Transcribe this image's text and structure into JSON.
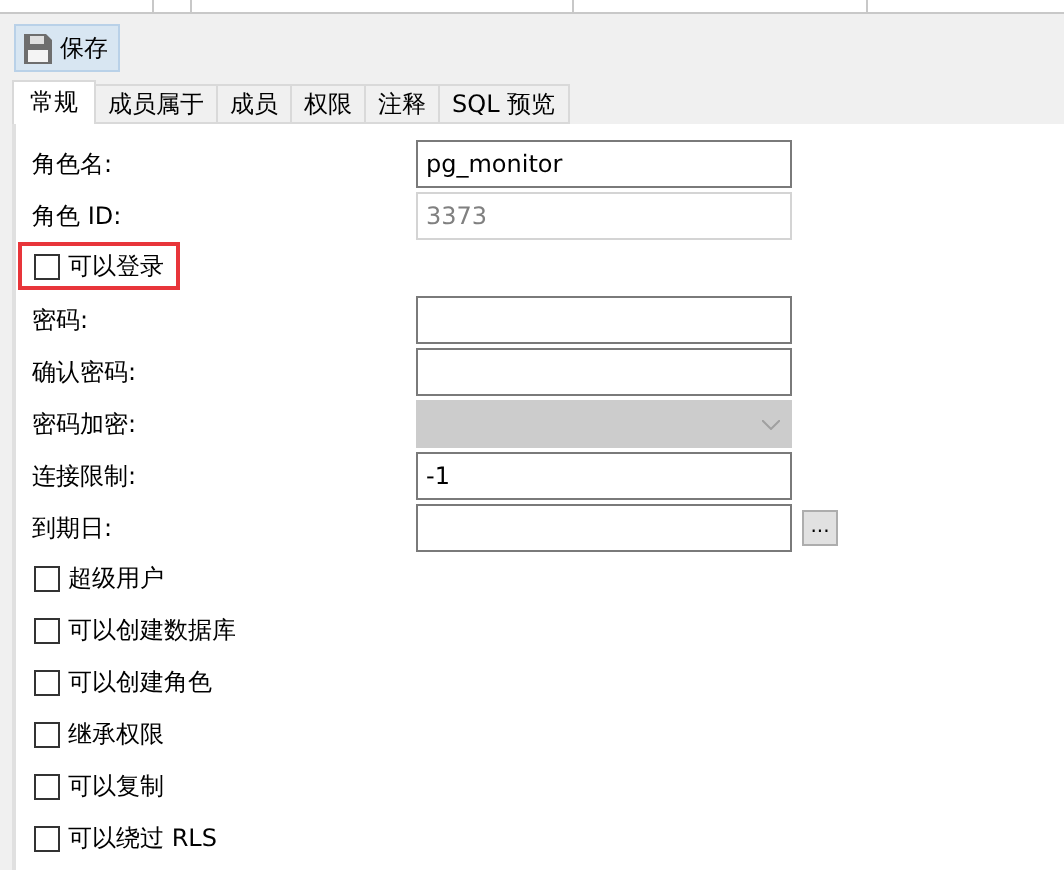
{
  "toolbar": {
    "save_button": "保存"
  },
  "tabs": [
    {
      "label": "常规",
      "selected": true
    },
    {
      "label": "成员属于",
      "selected": false
    },
    {
      "label": "成员",
      "selected": false
    },
    {
      "label": "权限",
      "selected": false
    },
    {
      "label": "注释",
      "selected": false
    },
    {
      "label": "SQL 预览",
      "selected": false
    }
  ],
  "form": {
    "rows": [
      {
        "kind": "text",
        "label": "角色名:",
        "value": "pg_monitor",
        "disabled": false
      },
      {
        "kind": "text",
        "label": "角色 ID:",
        "value": "3373",
        "disabled": true
      },
      {
        "kind": "checkbox",
        "label": "可以登录",
        "checked": false,
        "highlighted": true
      },
      {
        "kind": "text",
        "label": "密码:",
        "disabled": false
      },
      {
        "kind": "text",
        "label": "确认密码:",
        "disabled": false
      },
      {
        "kind": "select",
        "label": "密码加密:",
        "disabled": true
      },
      {
        "kind": "text",
        "label": "连接限制:",
        "value": "-1",
        "disabled": false
      },
      {
        "kind": "date",
        "label": "到期日:",
        "button": "...",
        "disabled": false
      },
      {
        "kind": "checkbox",
        "label": "超级用户",
        "checked": false,
        "highlighted": false
      },
      {
        "kind": "checkbox",
        "label": "可以创建数据库",
        "checked": false,
        "highlighted": false
      },
      {
        "kind": "checkbox",
        "label": "可以创建角色",
        "checked": false,
        "highlighted": false
      },
      {
        "kind": "checkbox",
        "label": "继承权限",
        "checked": false,
        "highlighted": false
      },
      {
        "kind": "checkbox",
        "label": "可以复制",
        "checked": false,
        "highlighted": false
      },
      {
        "kind": "checkbox",
        "label": "可以绕过 RLS",
        "checked": false,
        "highlighted": false
      }
    ]
  }
}
